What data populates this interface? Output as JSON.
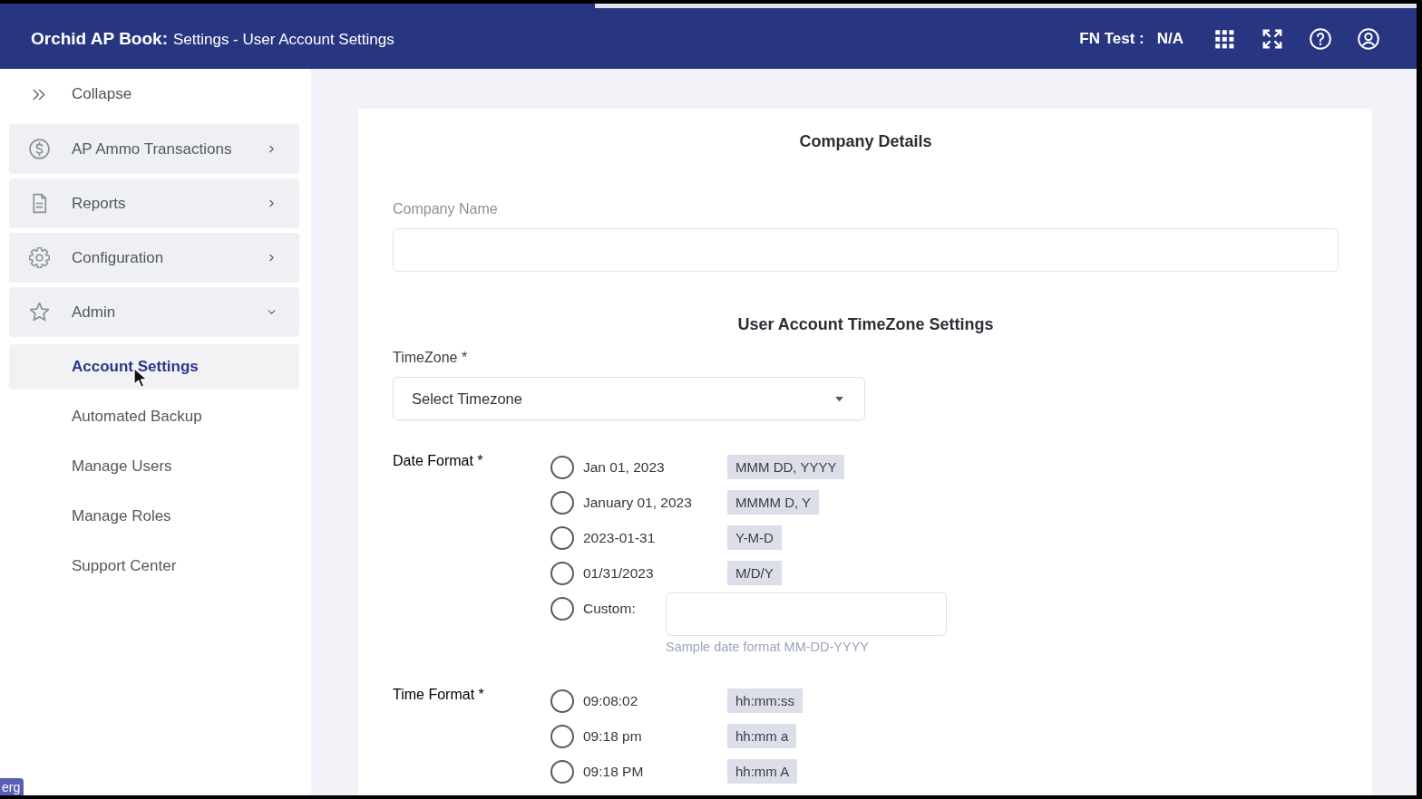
{
  "loading_bar": {
    "level": 0.42
  },
  "header": {
    "app_name": "Orchid AP Book:",
    "page_title": "Settings - User Account Settings",
    "env_label": "FN Test :",
    "env_value": "N/A"
  },
  "sidebar": {
    "collapse_label": "Collapse",
    "items": [
      {
        "label": "AP Ammo Transactions",
        "expanded": false
      },
      {
        "label": "Reports",
        "expanded": false
      },
      {
        "label": "Configuration",
        "expanded": false
      },
      {
        "label": "Admin",
        "expanded": true,
        "children": [
          {
            "label": "Account Settings",
            "selected": true
          },
          {
            "label": "Automated Backup",
            "selected": false
          },
          {
            "label": "Manage Users",
            "selected": false
          },
          {
            "label": "Manage Roles",
            "selected": false
          },
          {
            "label": "Support Center",
            "selected": false
          }
        ]
      }
    ]
  },
  "company_details": {
    "title": "Company Details",
    "company_name": {
      "label": "Company Name"
    }
  },
  "timezone_settings": {
    "title": "User Account TimeZone Settings",
    "timezone": {
      "label": "TimeZone *",
      "value": "Select Timezone"
    },
    "date_format": {
      "label": "Date Format *",
      "options": [
        {
          "kind": "preset",
          "label": "Jan 01, 2023",
          "pattern": "MMM DD, YYYY",
          "selected": false
        },
        {
          "kind": "preset",
          "label": "January 01, 2023",
          "pattern": "MMMM D, Y",
          "selected": false
        },
        {
          "kind": "preset",
          "label": "2023-01-31",
          "pattern": "Y-M-D",
          "selected": false
        },
        {
          "kind": "preset",
          "label": "01/31/2023",
          "pattern": "M/D/Y",
          "selected": false
        },
        {
          "kind": "custom",
          "label": "Custom:",
          "hint": "Sample date format MM-DD-YYYY",
          "selected": false
        }
      ]
    },
    "time_format": {
      "label": "Time Format *",
      "options": [
        {
          "kind": "preset",
          "label": "09:08:02",
          "pattern": "hh:mm:ss",
          "selected": false
        },
        {
          "kind": "preset",
          "label": "09:18 pm",
          "pattern": "hh:mm a",
          "selected": false
        },
        {
          "kind": "preset",
          "label": "09:18 PM",
          "pattern": "hh:mm A",
          "selected": false
        }
      ]
    }
  },
  "corner_badge": "erg"
}
